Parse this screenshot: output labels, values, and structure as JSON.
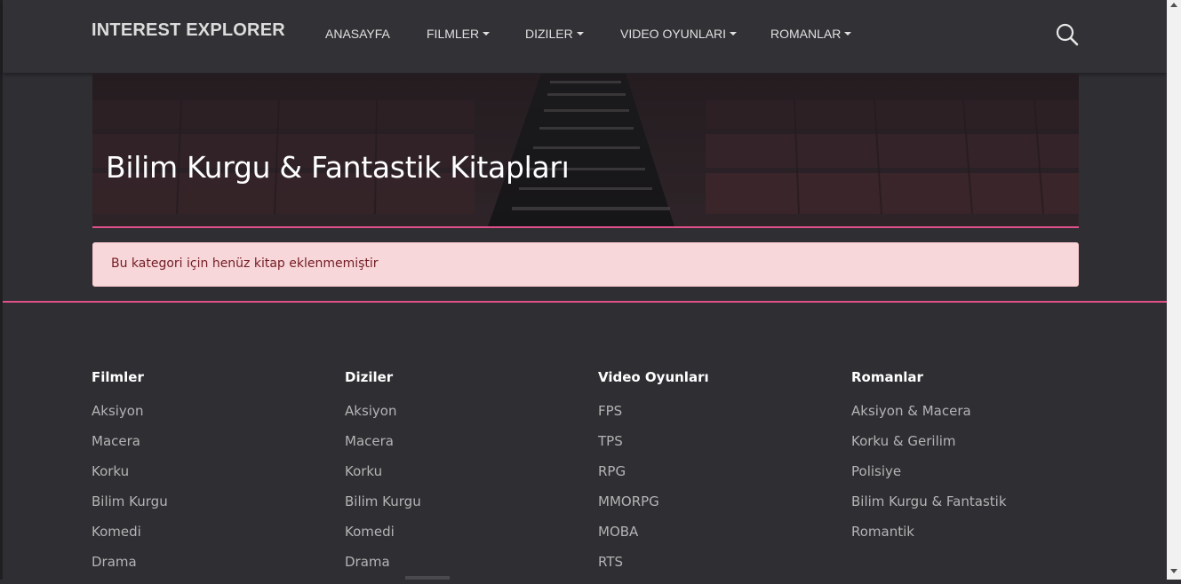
{
  "navbar": {
    "brand": "INTEREST EXPLORER",
    "items": [
      {
        "label": "ANASAYFA",
        "dropdown": false
      },
      {
        "label": "FILMLER",
        "dropdown": true
      },
      {
        "label": "DIZILER",
        "dropdown": true
      },
      {
        "label": "VIDEO OYUNLARI",
        "dropdown": true
      },
      {
        "label": "ROMANLAR",
        "dropdown": true
      }
    ],
    "search_icon": "search-icon"
  },
  "hero": {
    "title": "Bilim Kurgu & Fantastik Kitapları",
    "accent_color": "#e0508a"
  },
  "alert": {
    "text": "Bu kategori için henüz kitap eklenmemiştir",
    "background": "#f8d7da",
    "text_color": "#721c24"
  },
  "footer": {
    "columns": [
      {
        "heading": "Filmler",
        "links": [
          "Aksiyon",
          "Macera",
          "Korku",
          "Bilim Kurgu",
          "Komedi",
          "Drama"
        ]
      },
      {
        "heading": "Diziler",
        "links": [
          "Aksiyon",
          "Macera",
          "Korku",
          "Bilim Kurgu",
          "Komedi",
          "Drama"
        ]
      },
      {
        "heading": "Video Oyunları",
        "links": [
          "FPS",
          "TPS",
          "RPG",
          "MMORPG",
          "MOBA",
          "RTS"
        ]
      },
      {
        "heading": "Romanlar",
        "links": [
          "Aksiyon & Macera",
          "Korku & Gerilim",
          "Polisiye",
          "Bilim Kurgu & Fantastik",
          "Romantik"
        ]
      }
    ]
  },
  "colors": {
    "background": "#2f2e33",
    "navbar": "#323135",
    "accent": "#e0508a"
  }
}
